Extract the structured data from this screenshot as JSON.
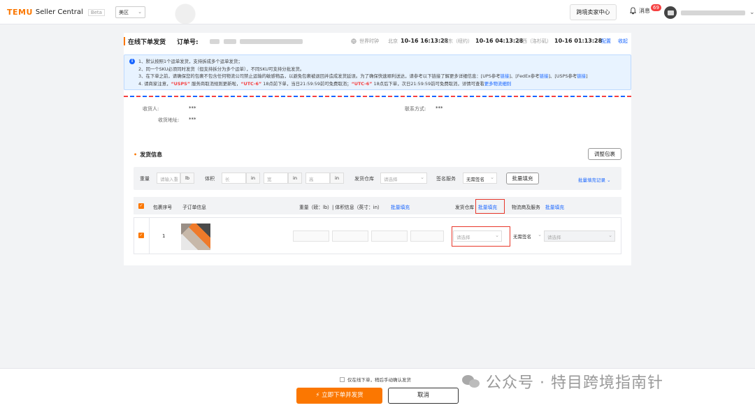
{
  "topbar": {
    "brand": "TEMU",
    "product": "Seller Central",
    "beta": "Beta",
    "region": "美区",
    "center_button": "跨境卖家中心",
    "messages_label": "消息",
    "messages_count": "69"
  },
  "header": {
    "title": "在线下单发货",
    "order_label": "订单号:",
    "world_clock": "世界时钟",
    "timezones": [
      {
        "city": "北京",
        "time": "10-16 16:13:28"
      },
      {
        "city": "美东（纽约）",
        "time": "10-16 04:13:28"
      },
      {
        "city": "美西（洛杉矶）",
        "time": "10-16 01:13:28"
      }
    ],
    "config_link": "配置",
    "collapse_link": "收起"
  },
  "notice": {
    "line1": "1、默认按照1个运单发货，支持拆成多个运单发货；",
    "line2": "2、同一个SKU必须同时发货（但支持拆分为多个运单），不同SKU可支持分批发货。",
    "line3_a": "3、在下单之前，请确保您的包裹不包含任何物流公司禁止运输的敏感物品，以避免包裹被退回并造成发货延误。为了确保快速顺利送达，请参考以下链接了解更多详细信息：[UPS参考",
    "line3_link1": "链接",
    "line3_b": "]、[FedEx参考",
    "line3_link2": "链接",
    "line3_c": "]、[USPS参考",
    "line3_link3": "链接",
    "line3_d": "]",
    "line4_a": "4. 请商家注意，",
    "line4_usps": "“USPS”",
    "line4_b": "服务商取消规则更新啦，",
    "line4_utc1": "“UTC-6”",
    "line4_c": "18点前下单，当日21:59:59前可免费取消；",
    "line4_utc2": "“UTC-6”",
    "line4_d": "18点后下单，次日21:59:59前可免费取消，详情可查看",
    "line4_link": "更多物流细则"
  },
  "recipient": {
    "name_label": "收货人:",
    "name_value": "***",
    "contact_label": "联系方式:",
    "contact_value": "***",
    "address_label": "收货地址:",
    "address_value": "***"
  },
  "shipping": {
    "title": "发货信息",
    "adjust_button": "调整包裹",
    "filter": {
      "weight_label": "重量",
      "weight_placeholder": "请输入重",
      "weight_unit": "lb",
      "volume_label": "体积",
      "length_placeholder": "长",
      "width_placeholder": "宽",
      "height_placeholder": "高",
      "dim_unit": "in",
      "warehouse_label": "发货仓库",
      "warehouse_placeholder": "请选择",
      "sign_label": "签名服务",
      "sign_value": "无需签名",
      "fill_button": "批量填充",
      "history_link": "批量填充记录"
    },
    "columns": {
      "package_no": "包裹序号",
      "sub_order": "子订单信息",
      "weight_volume": "重量（磅：lb）| 体积信息（英寸：in）",
      "batch_fill": "批量填充",
      "warehouse": "发货仓库",
      "carrier": "物流商及服务"
    },
    "rows": [
      {
        "index": "1",
        "warehouse_placeholder": "请选择",
        "sign_value": "无需签名",
        "carrier_placeholder": "请选择"
      }
    ]
  },
  "footer": {
    "confirm_text": "仅在线下单，稍后手动确认发货",
    "primary_button": "立即下单并发货",
    "cancel_button": "取消"
  },
  "watermark": "公众号 · 特目跨境指南针"
}
